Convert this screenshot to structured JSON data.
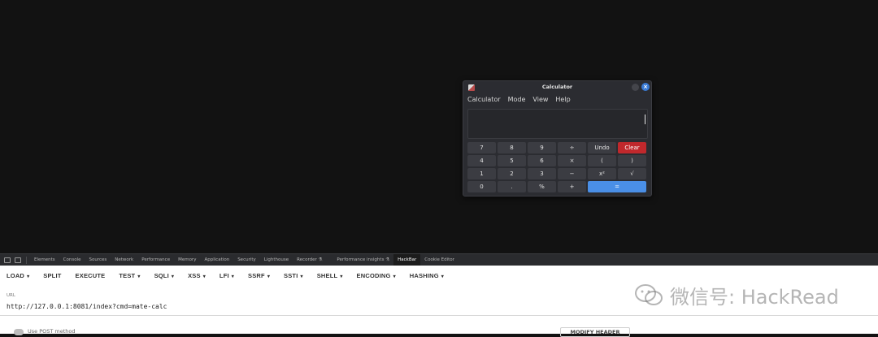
{
  "calculator": {
    "title": "Calculator",
    "menu": [
      "Calculator",
      "Mode",
      "View",
      "Help"
    ],
    "display_value": "",
    "keys": [
      {
        "label": "7",
        "name": "key-7"
      },
      {
        "label": "8",
        "name": "key-8"
      },
      {
        "label": "9",
        "name": "key-9"
      },
      {
        "label": "÷",
        "name": "key-divide"
      },
      {
        "label": "Undo",
        "name": "key-undo"
      },
      {
        "label": "Clear",
        "name": "key-clear"
      },
      {
        "label": "4",
        "name": "key-4"
      },
      {
        "label": "5",
        "name": "key-5"
      },
      {
        "label": "6",
        "name": "key-6"
      },
      {
        "label": "×",
        "name": "key-multiply"
      },
      {
        "label": "(",
        "name": "key-open-paren"
      },
      {
        "label": ")",
        "name": "key-close-paren"
      },
      {
        "label": "1",
        "name": "key-1"
      },
      {
        "label": "2",
        "name": "key-2"
      },
      {
        "label": "3",
        "name": "key-3"
      },
      {
        "label": "−",
        "name": "key-subtract"
      },
      {
        "label": "x²",
        "name": "key-square"
      },
      {
        "label": "√",
        "name": "key-sqrt"
      },
      {
        "label": "0",
        "name": "key-0"
      },
      {
        "label": ".",
        "name": "key-decimal"
      },
      {
        "label": "%",
        "name": "key-percent"
      },
      {
        "label": "+",
        "name": "key-add"
      },
      {
        "label": "=",
        "name": "key-equals"
      }
    ],
    "colors": {
      "clear": "#c0282c",
      "equals": "#4a8fe7",
      "close": "#3a7bd5"
    }
  },
  "devtools": {
    "tabs": [
      "Elements",
      "Console",
      "Sources",
      "Network",
      "Performance",
      "Memory",
      "Application",
      "Security",
      "Lighthouse",
      "Recorder ⚗",
      "Performance insights ⚗",
      "HackBar",
      "Cookie Editor"
    ],
    "active_tab": "HackBar"
  },
  "hackbar": {
    "buttons": [
      "LOAD",
      "SPLIT",
      "EXECUTE",
      "TEST",
      "SQLI",
      "XSS",
      "LFI",
      "SSRF",
      "SSTI",
      "SHELL",
      "ENCODING",
      "HASHING"
    ],
    "dropdown_caret": "▾",
    "url_label": "URL",
    "url_value": "http://127.0.0.1:8081/index?cmd=mate-calc",
    "post_label": "Use POST method",
    "modify_header_label": "MODIFY HEADER"
  },
  "watermark": {
    "text": "微信号: HackRead"
  }
}
